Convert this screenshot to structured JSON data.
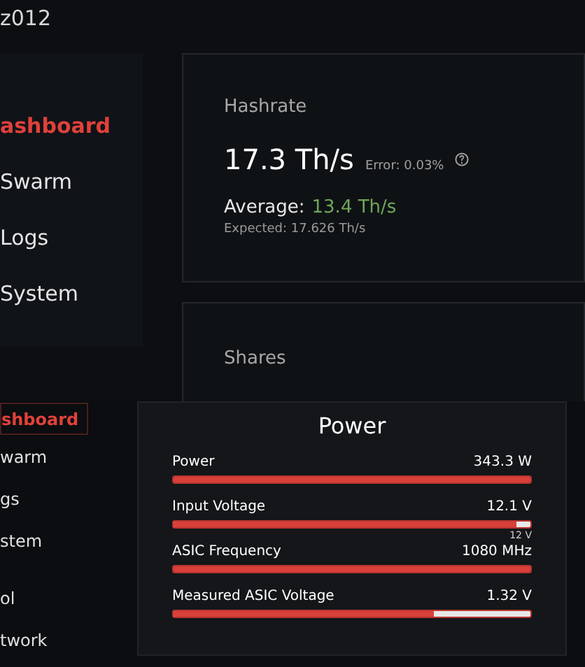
{
  "header": {
    "title": "z012"
  },
  "sidebar": {
    "items": [
      {
        "label": "ashboard",
        "selected": true
      },
      {
        "label": "Swarm",
        "selected": false
      },
      {
        "label": "Logs",
        "selected": false
      },
      {
        "label": "System",
        "selected": false
      }
    ]
  },
  "hashrate": {
    "title": "Hashrate",
    "value": "17.3 Th/s",
    "error": "Error: 0.03%",
    "average_label": "Average:",
    "average_value": "13.4 Th/s",
    "expected": "Expected: 17.626 Th/s"
  },
  "shares": {
    "title": "Shares"
  },
  "overlay": {
    "sidebar": {
      "items": [
        {
          "label": "shboard",
          "selected": true
        },
        {
          "label": "warm",
          "selected": false
        },
        {
          "label": "gs",
          "selected": false
        },
        {
          "label": "stem",
          "selected": false
        },
        {
          "label": "ol",
          "selected": false
        },
        {
          "label": "twork",
          "selected": false
        }
      ]
    },
    "power": {
      "title": "Power",
      "metrics": [
        {
          "label": "Power",
          "reading": "343.3 W",
          "level": 1
        },
        {
          "label": "Input Voltage",
          "reading": "12.1 V",
          "level": 0.96,
          "marker": "12 V"
        },
        {
          "label": "ASIC Frequency",
          "reading": "1080 MHz",
          "level": 1
        },
        {
          "label": "Measured ASIC Voltage",
          "reading": "1.32 V",
          "level": 0.73
        }
      ]
    }
  }
}
